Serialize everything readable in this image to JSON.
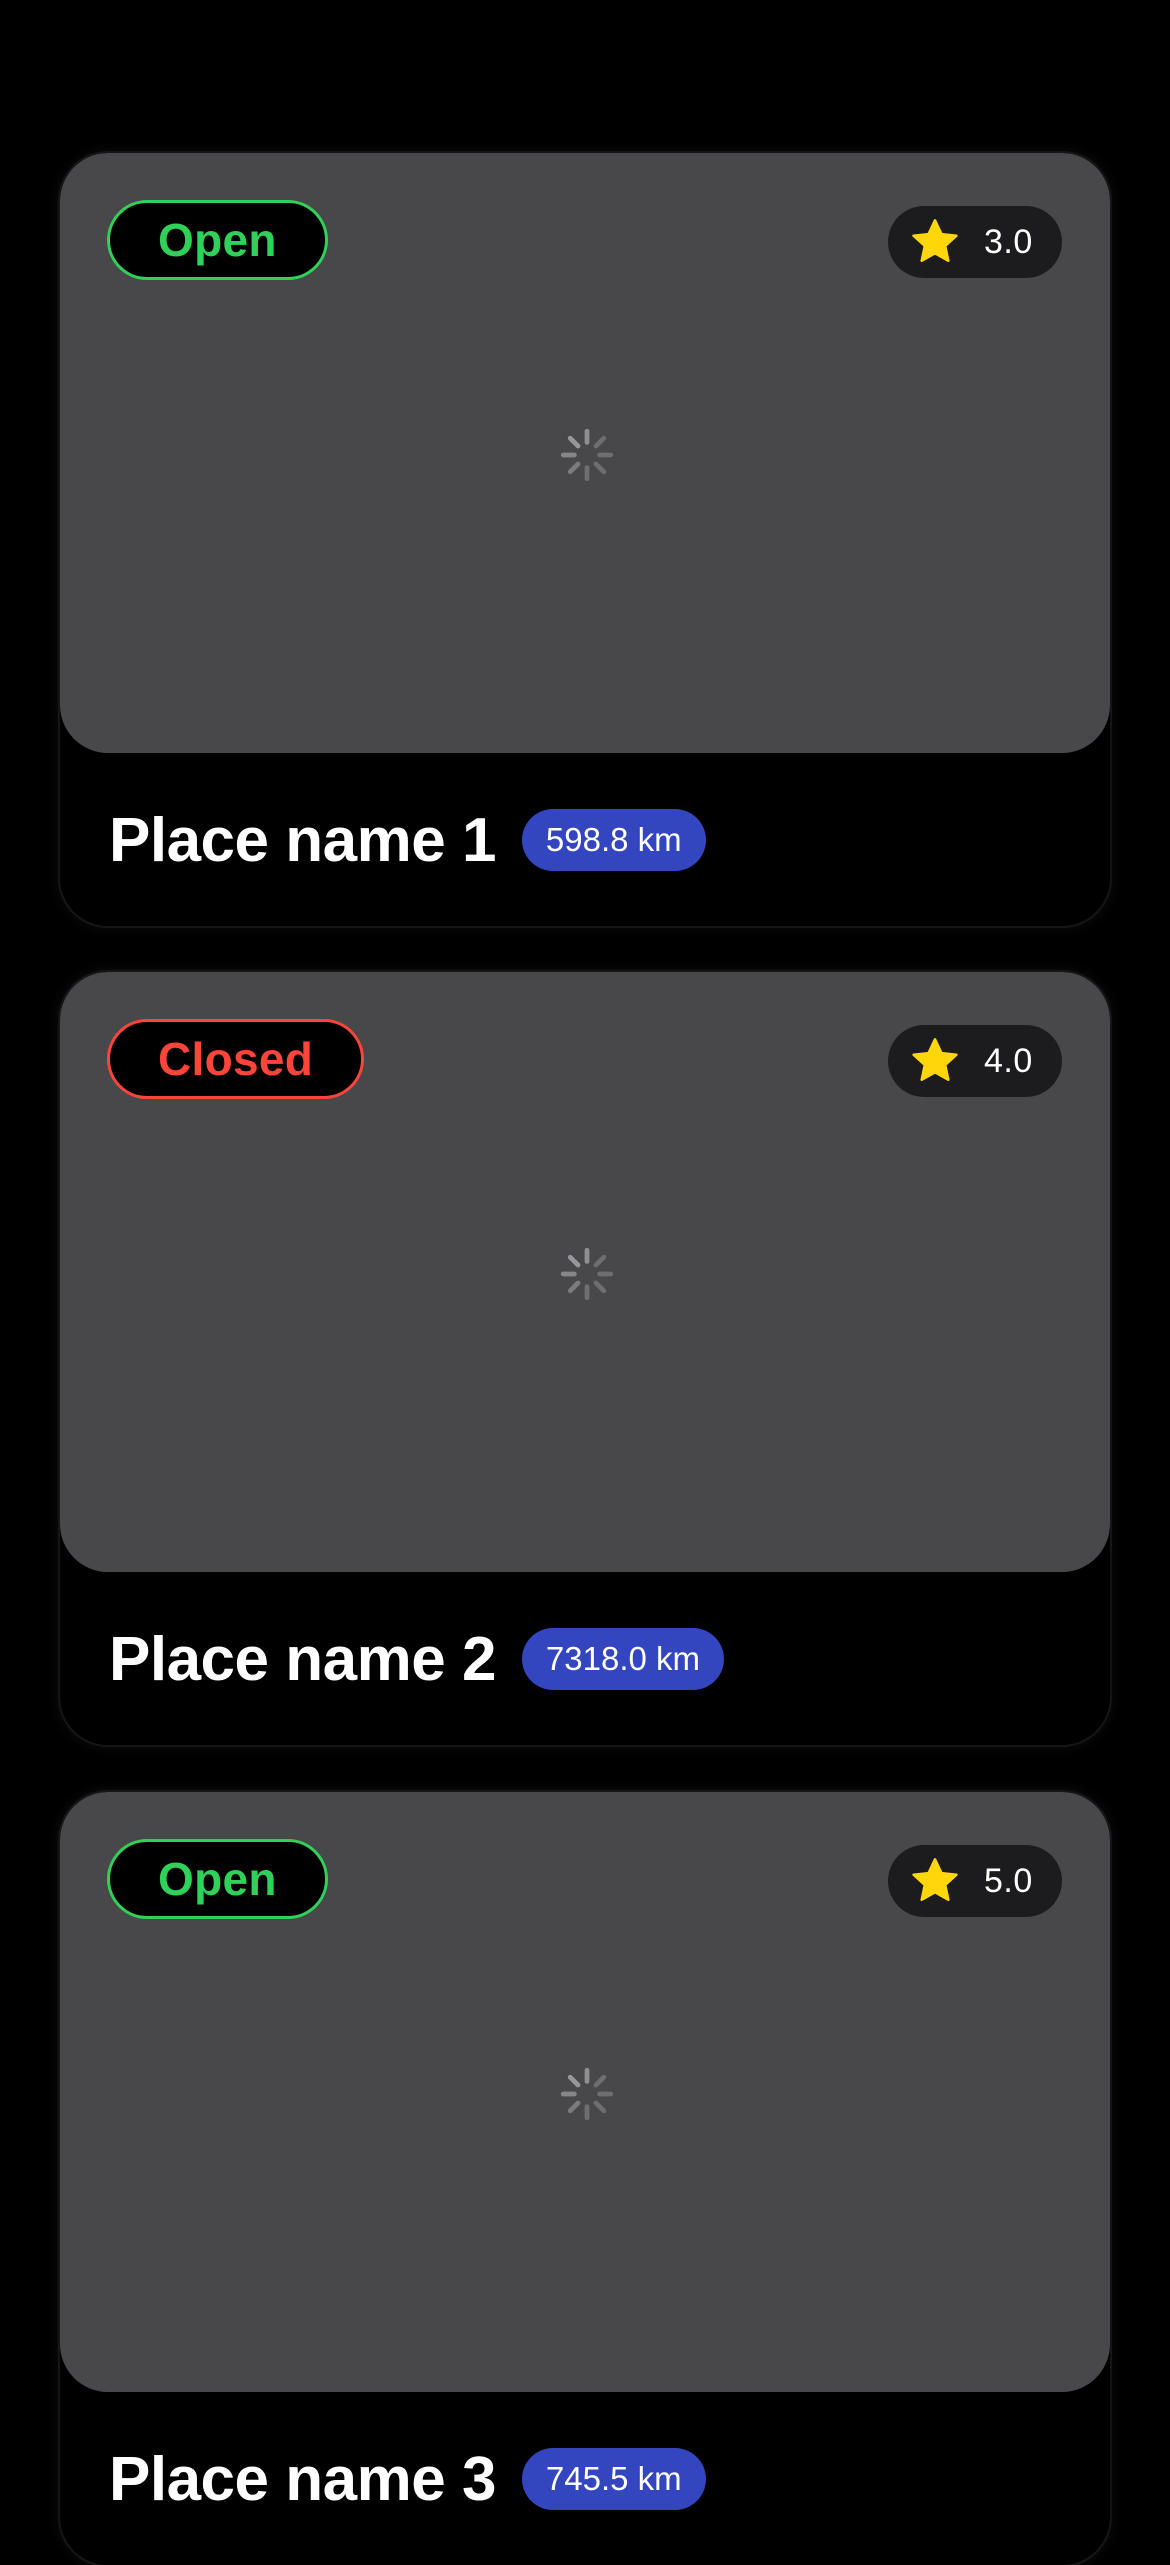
{
  "colors": {
    "background": "#000000",
    "image_placeholder": "#48484a",
    "open_status": "#30d158",
    "closed_status": "#ff453a",
    "star": "#ffd60a",
    "distance_badge": "#3346c0",
    "rating_pill": "#1c1c1e"
  },
  "places": [
    {
      "status": "Open",
      "status_state": "open",
      "rating": "3.0",
      "name": "Place name 1",
      "distance": "598.8 km",
      "rating_icon": "star-icon",
      "image_state": "loading-spinner-icon"
    },
    {
      "status": "Closed",
      "status_state": "closed",
      "rating": "4.0",
      "name": "Place name 2",
      "distance": "7318.0 km",
      "rating_icon": "star-icon",
      "image_state": "loading-spinner-icon"
    },
    {
      "status": "Open",
      "status_state": "open",
      "rating": "5.0",
      "name": "Place name 3",
      "distance": "745.5 km",
      "rating_icon": "star-icon",
      "image_state": "loading-spinner-icon"
    }
  ]
}
